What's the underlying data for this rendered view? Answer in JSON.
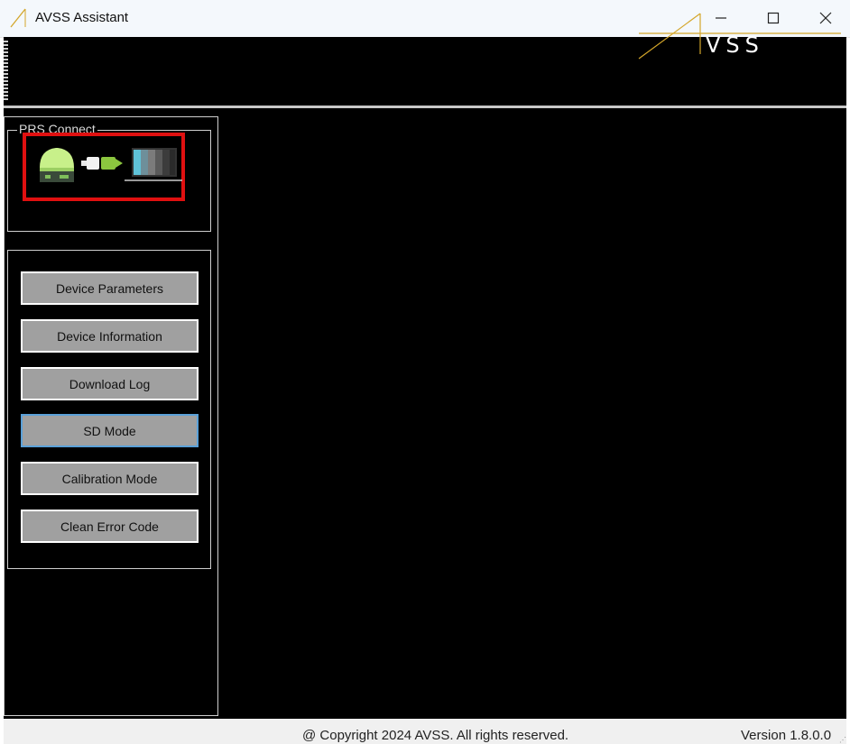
{
  "window": {
    "title": "AVSS Assistant",
    "controls": [
      "minimize",
      "maximize",
      "close"
    ]
  },
  "header": {
    "logo_text": "VSS",
    "accent_color": "#d4a62a"
  },
  "prs_group": {
    "label": "PRS Connect",
    "status_icon": "device-cable-monitor-connection-icon",
    "highlight_color": "#e01010"
  },
  "actions": {
    "device_parameters": "Device Parameters",
    "device_information": "Device Information",
    "download_log": "Download Log",
    "sd_mode": "SD Mode",
    "calibration_mode": "Calibration Mode",
    "clean_error_code": "Clean Error Code"
  },
  "status": {
    "copyright": "@ Copyright 2024 AVSS. All rights reserved.",
    "version": "Version 1.8.0.0"
  }
}
